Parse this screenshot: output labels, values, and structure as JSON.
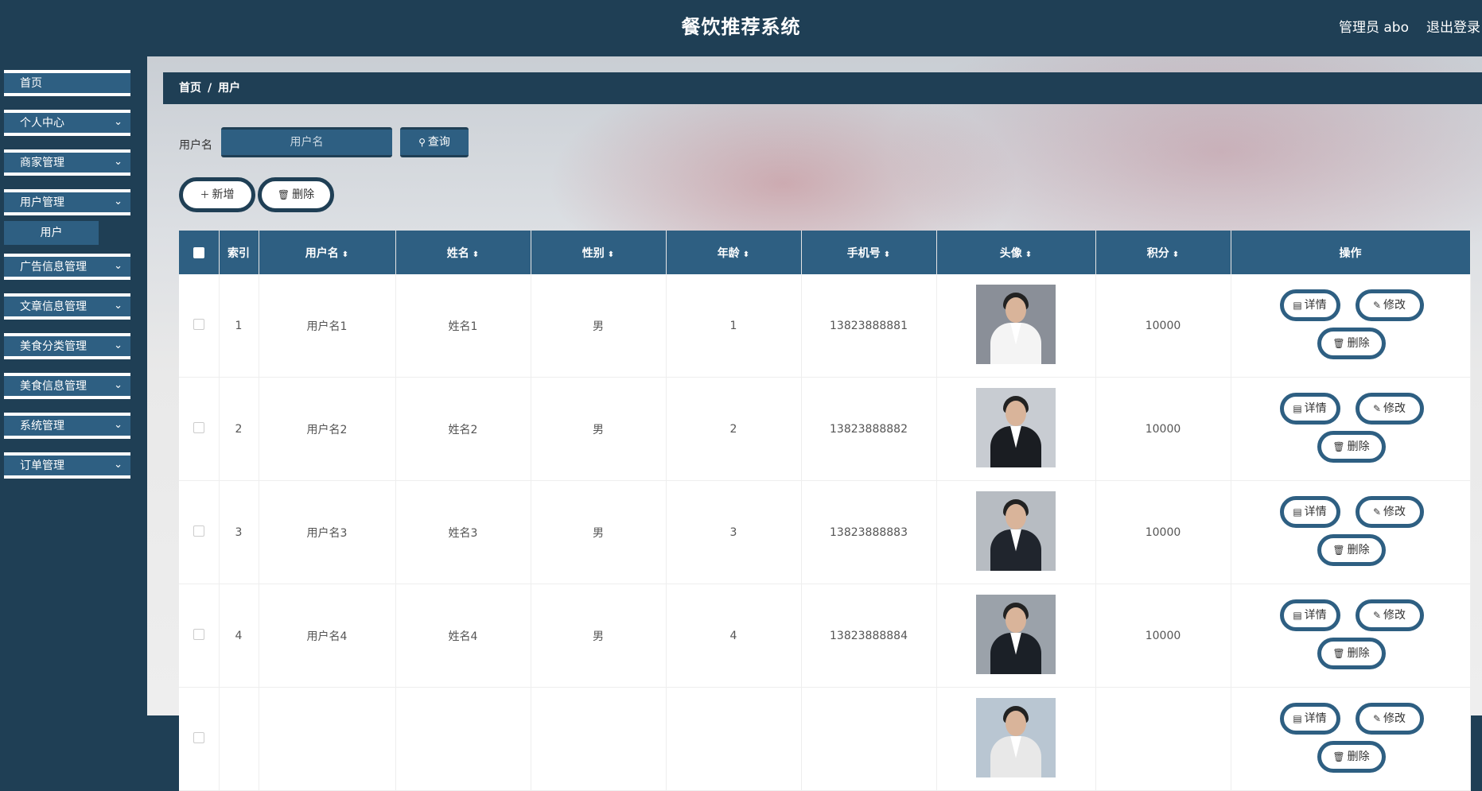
{
  "header": {
    "title": "餐饮推荐系统",
    "user": "管理员 abo",
    "logout": "退出登录"
  },
  "sidebar": {
    "items": [
      {
        "label": "首页",
        "chevron": ""
      },
      {
        "label": "个人中心",
        "chevron": "⌄"
      },
      {
        "label": "商家管理",
        "chevron": "⌄"
      },
      {
        "label": "用户管理",
        "chevron": "⌄"
      },
      {
        "label": "广告信息管理",
        "chevron": "⌄"
      },
      {
        "label": "文章信息管理",
        "chevron": "⌄"
      },
      {
        "label": "美食分类管理",
        "chevron": "⌄"
      },
      {
        "label": "美食信息管理",
        "chevron": "⌄"
      },
      {
        "label": "系统管理",
        "chevron": "⌄"
      },
      {
        "label": "订单管理",
        "chevron": "⌄"
      }
    ],
    "sub_item": "用户"
  },
  "breadcrumb": {
    "home": "首页",
    "sep": "/",
    "current": "用户"
  },
  "search": {
    "label": "用户名",
    "placeholder": "用户名",
    "button": "查询"
  },
  "actions": {
    "add": "新增",
    "delete": "删除"
  },
  "table": {
    "columns": [
      "索引",
      "用户名",
      "姓名",
      "性别",
      "年龄",
      "手机号",
      "头像",
      "积分",
      "操作"
    ],
    "rows": [
      {
        "index": "1",
        "username": "用户名1",
        "name": "姓名1",
        "gender": "男",
        "age": "1",
        "phone": "13823888881",
        "points": "10000"
      },
      {
        "index": "2",
        "username": "用户名2",
        "name": "姓名2",
        "gender": "男",
        "age": "2",
        "phone": "13823888882",
        "points": "10000"
      },
      {
        "index": "3",
        "username": "用户名3",
        "name": "姓名3",
        "gender": "男",
        "age": "3",
        "phone": "13823888883",
        "points": "10000"
      },
      {
        "index": "4",
        "username": "用户名4",
        "name": "姓名4",
        "gender": "男",
        "age": "4",
        "phone": "13823888884",
        "points": "10000"
      },
      {
        "index": "",
        "username": "",
        "name": "",
        "gender": "",
        "age": "",
        "phone": "",
        "points": ""
      }
    ],
    "row_actions": {
      "detail": "详情",
      "edit": "修改",
      "delete": "删除"
    }
  },
  "colors": {
    "primary": "#2e5f82",
    "dark": "#1f3f55"
  },
  "icons": {
    "search": "search-icon",
    "plus": "plus-icon",
    "trash": "trash-icon",
    "detail": "document-icon",
    "edit": "pencil-icon",
    "sort": "sort-icon"
  }
}
